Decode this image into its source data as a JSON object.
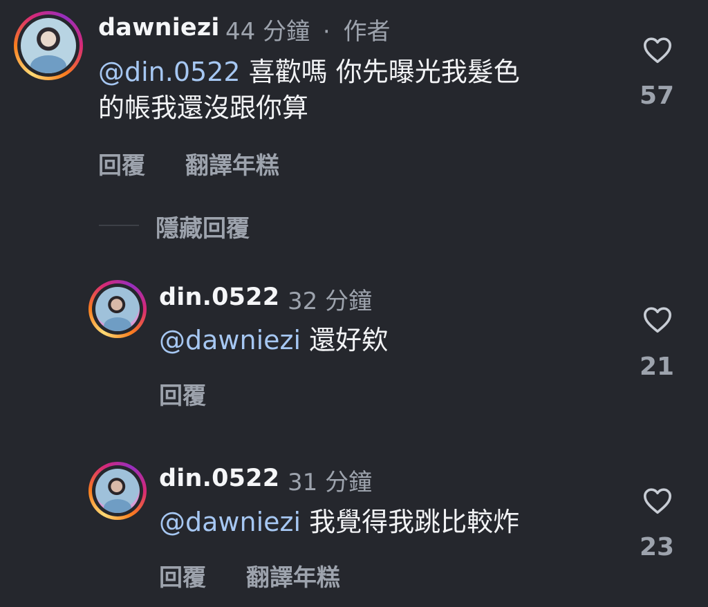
{
  "comments": [
    {
      "username": "dawniezi",
      "time": "44 分鐘",
      "separator": "·",
      "badge": "作者",
      "mention": "@din.0522",
      "text_line1": " 喜歡嗎 你先曝光我髮色",
      "text_line2": "的帳我還沒跟你算",
      "reply": "回覆",
      "translate": "翻譯年糕",
      "likes": "57"
    },
    {
      "username": "din.0522",
      "time": "32 分鐘",
      "mention": "@dawniezi",
      "text_line1": " 還好欸",
      "reply": "回覆",
      "likes": "21"
    },
    {
      "username": "din.0522",
      "time": "31 分鐘",
      "mention": "@dawniezi",
      "text_line1": " 我覺得我跳比較炸",
      "reply": "回覆",
      "translate": "翻譯年糕",
      "likes": "23"
    }
  ],
  "hide_replies": "隱藏回覆",
  "icons": {
    "like": "heart-outline-icon",
    "avatar": "profile-avatar"
  },
  "colors": {
    "background": "#25272d",
    "mention": "#a6c7f2",
    "secondary": "#9da3ad",
    "text": "#f2f3f5"
  }
}
